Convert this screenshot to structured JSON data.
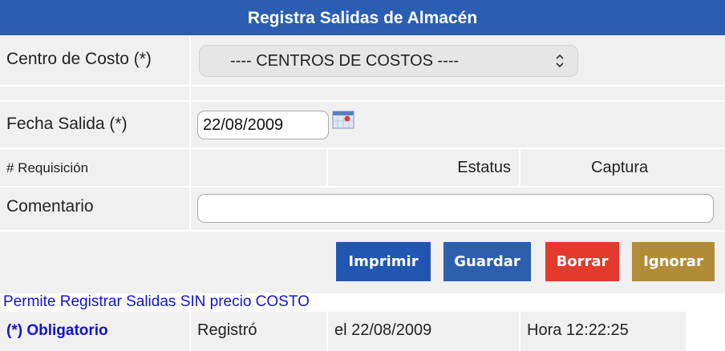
{
  "header": {
    "title": "Registra Salidas de Almacén"
  },
  "centro": {
    "label": "Centro de Costo (*)",
    "selected": "---- CENTROS DE COSTOS ----"
  },
  "fecha": {
    "label": "Fecha Salida (*)",
    "value": "22/08/2009"
  },
  "requisicion": {
    "label": "# Requisición",
    "estatus_label": "Estatus",
    "captura_label": "Captura"
  },
  "comentario": {
    "label": "Comentario",
    "value": ""
  },
  "buttons": {
    "imprimir": "Imprimir",
    "guardar": "Guardar",
    "borrar": "Borrar",
    "ignorar": "Ignorar"
  },
  "colors": {
    "header": "#2b5eb0",
    "imprimir": "#2156b3",
    "guardar": "#2c5fae",
    "borrar": "#e33a2d",
    "ignorar": "#b08c36",
    "note": "#1212d6"
  },
  "note": "Permite Registrar Salidas SIN precio COSTO",
  "footer": {
    "obligatorio": "(*) Obligatorio",
    "registro": "Registró",
    "fecha": "el 22/08/2009",
    "hora": "Hora 12:22:25"
  }
}
